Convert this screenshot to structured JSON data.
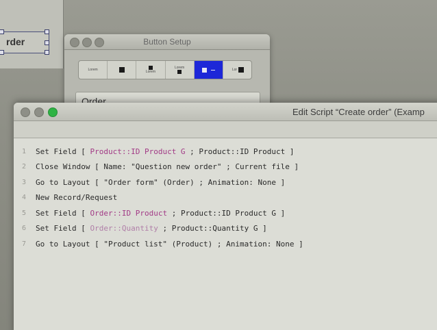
{
  "layout_object": {
    "label": "rder"
  },
  "button_setup": {
    "title": "Button Setup",
    "style_options": [
      {
        "label": "Lorem",
        "selected": false
      },
      {
        "label": "",
        "selected": false
      },
      {
        "label": "Lorem",
        "selected": false
      },
      {
        "label": "Lorem",
        "selected": false
      },
      {
        "label": "",
        "selected": true
      },
      {
        "label": "Lor",
        "selected": false
      }
    ],
    "field_value": "Order",
    "accent_color": "#1d27d8"
  },
  "edit_script": {
    "title": "Edit Script “Create order” (Examp",
    "lines": [
      {
        "num": "1",
        "parts": [
          {
            "t": "Set Field [ ",
            "s": "plain"
          },
          {
            "t": "Product::ID Product G",
            "s": "field"
          },
          {
            "t": " ; Product::ID Product ]",
            "s": "plain"
          }
        ]
      },
      {
        "num": "2",
        "parts": [
          {
            "t": "Close Window [ Name: \"Question new order\" ; Current file ]",
            "s": "plain"
          }
        ]
      },
      {
        "num": "3",
        "parts": [
          {
            "t": "Go to Layout [ \"Order form\" (Order) ; Animation: None ]",
            "s": "plain"
          }
        ]
      },
      {
        "num": "4",
        "parts": [
          {
            "t": "New Record/Request",
            "s": "plain"
          }
        ]
      },
      {
        "num": "5",
        "parts": [
          {
            "t": "Set Field [ ",
            "s": "plain"
          },
          {
            "t": "Order::ID Product",
            "s": "field"
          },
          {
            "t": " ; Product::ID Product G ]",
            "s": "plain"
          }
        ]
      },
      {
        "num": "6",
        "parts": [
          {
            "t": "Set Field [ ",
            "s": "plain"
          },
          {
            "t": "Order::Quantity",
            "s": "dim"
          },
          {
            "t": " ; Product::Quantity G ]",
            "s": "plain"
          }
        ]
      },
      {
        "num": "7",
        "parts": [
          {
            "t": "Go to Layout [ \"Product list\" (Product) ; Animation: None ]",
            "s": "plain"
          }
        ]
      }
    ]
  },
  "colors": {
    "field_ref": "#a23a86",
    "close_button": "#2fb344"
  }
}
